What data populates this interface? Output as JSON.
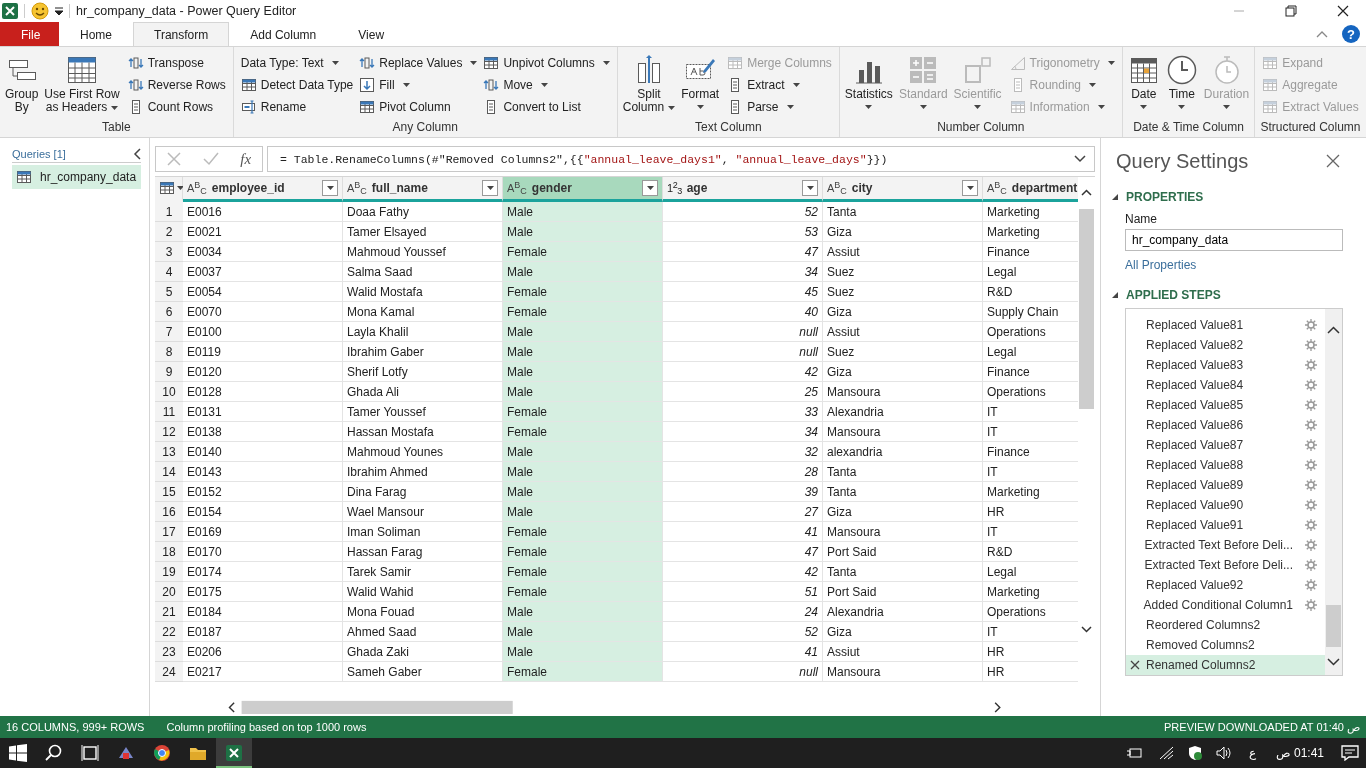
{
  "title_bar": {
    "title": "hr_company_data - Power Query Editor"
  },
  "tabs": [
    {
      "label": "File",
      "kind": "file",
      "selected": false
    },
    {
      "label": "Home",
      "kind": "tab",
      "selected": false
    },
    {
      "label": "Transform",
      "kind": "tab",
      "selected": true
    },
    {
      "label": "Add Column",
      "kind": "tab",
      "selected": false
    },
    {
      "label": "View",
      "kind": "tab",
      "selected": false
    }
  ],
  "help_button": "?",
  "ribbon": {
    "groups": [
      {
        "label": "Table",
        "items": [
          {
            "label": "Group\nBy",
            "kind": "large"
          },
          {
            "label": "Use First Row\nas Headers",
            "kind": "large",
            "dropdown": true
          },
          {
            "label": "Transpose",
            "kind": "small"
          },
          {
            "label": "Reverse Rows",
            "kind": "small"
          },
          {
            "label": "Count Rows",
            "kind": "small"
          }
        ]
      },
      {
        "label": "Any Column",
        "items": [
          {
            "label": "Data Type: Text",
            "kind": "small",
            "dropdown": true
          },
          {
            "label": "Detect Data Type",
            "kind": "small"
          },
          {
            "label": "Rename",
            "kind": "small"
          },
          {
            "label": "Replace Values",
            "kind": "small",
            "dropdown": true
          },
          {
            "label": "Fill",
            "kind": "small",
            "dropdown": true
          },
          {
            "label": "Pivot Column",
            "kind": "small"
          },
          {
            "label": "Unpivot Columns",
            "kind": "small",
            "dropdown": true
          },
          {
            "label": "Move",
            "kind": "small",
            "dropdown": true
          },
          {
            "label": "Convert to List",
            "kind": "small"
          }
        ]
      },
      {
        "label": "Text Column",
        "items": [
          {
            "label": "Split\nColumn",
            "kind": "large",
            "dropdown": true
          },
          {
            "label": "Format",
            "kind": "large",
            "dropdown": true,
            "caret_below": true
          },
          {
            "label": "Merge Columns",
            "kind": "small",
            "disabled": true
          },
          {
            "label": "Extract",
            "kind": "small",
            "dropdown": true
          },
          {
            "label": "Parse",
            "kind": "small",
            "dropdown": true
          }
        ]
      },
      {
        "label": "Number Column",
        "items": [
          {
            "label": "Statistics",
            "kind": "large",
            "dropdown": true,
            "caret_below": true
          },
          {
            "label": "Standard",
            "kind": "large",
            "dropdown": true,
            "caret_below": true,
            "disabled": true
          },
          {
            "label": "Scientific",
            "kind": "large",
            "dropdown": true,
            "caret_below": true,
            "disabled": true
          },
          {
            "label": "Trigonometry",
            "kind": "small",
            "dropdown": true,
            "disabled": true
          },
          {
            "label": "Rounding",
            "kind": "small",
            "dropdown": true,
            "disabled": true
          },
          {
            "label": "Information",
            "kind": "small",
            "dropdown": true,
            "disabled": true
          }
        ]
      },
      {
        "label": "Date & Time Column",
        "items": [
          {
            "label": "Date",
            "kind": "large",
            "dropdown": true,
            "caret_below": true
          },
          {
            "label": "Time",
            "kind": "large",
            "dropdown": true,
            "caret_below": true
          },
          {
            "label": "Duration",
            "kind": "large",
            "dropdown": true,
            "caret_below": true,
            "disabled": true
          }
        ]
      },
      {
        "label": "Structured Column",
        "items": [
          {
            "label": "Expand",
            "kind": "small",
            "disabled": true
          },
          {
            "label": "Aggregate",
            "kind": "small",
            "disabled": true
          },
          {
            "label": "Extract Values",
            "kind": "small",
            "disabled": true
          }
        ]
      }
    ]
  },
  "queries": {
    "header": "Queries [1]",
    "items": [
      {
        "label": "hr_company_data",
        "selected": true
      }
    ]
  },
  "formula_bar": {
    "fx_label": "fx",
    "segments": [
      {
        "text": "= Table.RenameColumns(#\"Removed Columns2\",{{",
        "kind": "code"
      },
      {
        "text": "\"annual_leave_days1\"",
        "kind": "string"
      },
      {
        "text": ", ",
        "kind": "code"
      },
      {
        "text": "\"annual_leave_days\"",
        "kind": "string"
      },
      {
        "text": "}})",
        "kind": "code"
      }
    ]
  },
  "table": {
    "columns": [
      {
        "name": "employee_id",
        "type_label": "ABC",
        "numeric": false,
        "selected": false,
        "filter_button": true
      },
      {
        "name": "full_name",
        "type_label": "ABC",
        "numeric": false,
        "selected": false,
        "filter_button": true
      },
      {
        "name": "gender",
        "type_label": "ABC",
        "numeric": false,
        "selected": true,
        "filter_button": true
      },
      {
        "name": "age",
        "type_label": "123",
        "numeric": true,
        "selected": false,
        "filter_button": true
      },
      {
        "name": "city",
        "type_label": "ABC",
        "numeric": false,
        "selected": false,
        "filter_button": true
      },
      {
        "name": "department",
        "type_label": "ABC",
        "numeric": false,
        "selected": false,
        "filter_button": false
      }
    ],
    "rows": [
      {
        "n": "1",
        "cells": [
          "E0016",
          "Doaa Fathy",
          "Male",
          "52",
          "Tanta",
          "Marketing"
        ]
      },
      {
        "n": "2",
        "cells": [
          "E0021",
          "Tamer Elsayed",
          "Male",
          "53",
          "Giza",
          "Marketing"
        ]
      },
      {
        "n": "3",
        "cells": [
          "E0034",
          "Mahmoud Youssef",
          "Female",
          "47",
          "Assiut",
          "Finance"
        ]
      },
      {
        "n": "4",
        "cells": [
          "E0037",
          "Salma Saad",
          "Male",
          "34",
          "Suez",
          "Legal"
        ]
      },
      {
        "n": "5",
        "cells": [
          "E0054",
          "Walid Mostafa",
          "Female",
          "45",
          "Suez",
          "R&D"
        ]
      },
      {
        "n": "6",
        "cells": [
          "E0070",
          "Mona Kamal",
          "Female",
          "40",
          "Giza",
          "Supply Chain"
        ]
      },
      {
        "n": "7",
        "cells": [
          "E0100",
          "Layla Khalil",
          "Male",
          "null",
          "Assiut",
          "Operations"
        ]
      },
      {
        "n": "8",
        "cells": [
          "E0119",
          "Ibrahim Gaber",
          "Male",
          "null",
          "Suez",
          "Legal"
        ]
      },
      {
        "n": "9",
        "cells": [
          "E0120",
          "Sherif Lotfy",
          "Male",
          "42",
          "Giza",
          "Finance"
        ]
      },
      {
        "n": "10",
        "cells": [
          "E0128",
          "Ghada Ali",
          "Male",
          "25",
          "Mansoura",
          "Operations"
        ]
      },
      {
        "n": "11",
        "cells": [
          "E0131",
          "Tamer Youssef",
          "Female",
          "33",
          "Alexandria",
          "IT"
        ]
      },
      {
        "n": "12",
        "cells": [
          "E0138",
          "Hassan Mostafa",
          "Female",
          "34",
          "Mansoura",
          "IT"
        ]
      },
      {
        "n": "13",
        "cells": [
          "E0140",
          "Mahmoud Younes",
          "Male",
          "32",
          "alexandria",
          "Finance"
        ]
      },
      {
        "n": "14",
        "cells": [
          "E0143",
          "Ibrahim Ahmed",
          "Male",
          "28",
          "Tanta",
          "IT"
        ]
      },
      {
        "n": "15",
        "cells": [
          "E0152",
          "Dina Farag",
          "Male",
          "39",
          "Tanta",
          "Marketing"
        ]
      },
      {
        "n": "16",
        "cells": [
          "E0154",
          "Wael Mansour",
          "Male",
          "27",
          "Giza",
          "HR"
        ]
      },
      {
        "n": "17",
        "cells": [
          "E0169",
          "Iman Soliman",
          "Female",
          "41",
          "Mansoura",
          "IT"
        ]
      },
      {
        "n": "18",
        "cells": [
          "E0170",
          "Hassan Farag",
          "Female",
          "47",
          "Port Said",
          "R&D"
        ]
      },
      {
        "n": "19",
        "cells": [
          "E0174",
          "Tarek Samir",
          "Female",
          "42",
          "Tanta",
          "Legal"
        ]
      },
      {
        "n": "20",
        "cells": [
          "E0175",
          "Walid Wahid",
          "Female",
          "51",
          "Port Said",
          "Marketing"
        ]
      },
      {
        "n": "21",
        "cells": [
          "E0184",
          "Mona Fouad",
          "Male",
          "24",
          "Alexandria",
          "Operations"
        ]
      },
      {
        "n": "22",
        "cells": [
          "E0187",
          "Ahmed Saad",
          "Male",
          "52",
          "Giza",
          "IT"
        ]
      },
      {
        "n": "23",
        "cells": [
          "E0206",
          "Ghada Zaki",
          "Male",
          "41",
          "Assiut",
          "HR"
        ]
      },
      {
        "n": "24",
        "cells": [
          "E0217",
          "Sameh Gaber",
          "Female",
          "null",
          "Mansoura",
          "HR"
        ]
      }
    ]
  },
  "query_settings": {
    "title": "Query Settings",
    "properties_header": "PROPERTIES",
    "name_label": "Name",
    "name_value": "hr_company_data",
    "all_properties": "All Properties",
    "steps_header": "APPLIED STEPS",
    "steps": [
      {
        "label": "Replaced Value81",
        "has_settings": true,
        "selected": false
      },
      {
        "label": "Replaced Value82",
        "has_settings": true,
        "selected": false
      },
      {
        "label": "Replaced Value83",
        "has_settings": true,
        "selected": false
      },
      {
        "label": "Replaced Value84",
        "has_settings": true,
        "selected": false
      },
      {
        "label": "Replaced Value85",
        "has_settings": true,
        "selected": false
      },
      {
        "label": "Replaced Value86",
        "has_settings": true,
        "selected": false
      },
      {
        "label": "Replaced Value87",
        "has_settings": true,
        "selected": false
      },
      {
        "label": "Replaced Value88",
        "has_settings": true,
        "selected": false
      },
      {
        "label": "Replaced Value89",
        "has_settings": true,
        "selected": false
      },
      {
        "label": "Replaced Value90",
        "has_settings": true,
        "selected": false
      },
      {
        "label": "Replaced Value91",
        "has_settings": true,
        "selected": false
      },
      {
        "label": "Extracted Text Before Deli...",
        "has_settings": true,
        "selected": false
      },
      {
        "label": "Extracted Text Before Deli...",
        "has_settings": true,
        "selected": false
      },
      {
        "label": "Replaced Value92",
        "has_settings": true,
        "selected": false
      },
      {
        "label": "Added Conditional Column1",
        "has_settings": true,
        "selected": false
      },
      {
        "label": "Reordered Columns2",
        "has_settings": false,
        "selected": false
      },
      {
        "label": "Removed Columns2",
        "has_settings": false,
        "selected": false
      },
      {
        "label": "Renamed Columns2",
        "has_settings": false,
        "selected": true
      }
    ]
  },
  "status_bar": {
    "left": [
      "16 COLUMNS, 999+ ROWS",
      "Column profiling based on top 1000 rows"
    ],
    "right": "PREVIEW DOWNLOADED AT 01:40 ص"
  },
  "taskbar": {
    "apps": [
      {
        "kind": "start"
      },
      {
        "kind": "search"
      },
      {
        "kind": "taskview"
      },
      {
        "kind": "tool"
      },
      {
        "kind": "browser"
      },
      {
        "kind": "folder"
      },
      {
        "kind": "spreadsheet",
        "active": true
      }
    ],
    "language": "ع",
    "clock": "01:41 ص"
  }
}
